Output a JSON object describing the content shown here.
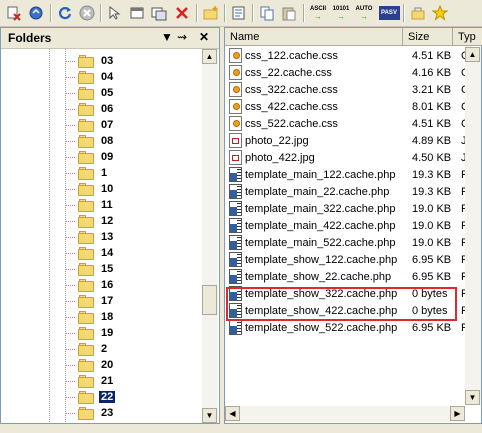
{
  "toolbar": {
    "buttons": [
      {
        "name": "disconnect-icon"
      },
      {
        "name": "reconnect-icon"
      },
      {
        "name": "refresh-icon"
      },
      {
        "name": "stop-icon"
      },
      {
        "name": "move-icon"
      },
      {
        "name": "copy-to-icon"
      },
      {
        "name": "move-to-icon"
      },
      {
        "name": "delete-icon"
      },
      {
        "name": "new-folder-icon"
      },
      {
        "name": "edit-icon"
      },
      {
        "name": "copy-icon"
      },
      {
        "name": "paste-icon"
      },
      {
        "name": "ascii-mode-icon"
      },
      {
        "name": "binary-mode-icon"
      },
      {
        "name": "auto-mode-icon"
      },
      {
        "name": "pasv-icon"
      },
      {
        "name": "add-favorite-icon"
      },
      {
        "name": "bookmark-star-icon"
      }
    ],
    "ascii_label": "ASCII",
    "binary_label": "10101",
    "auto_label": "AUTO",
    "pasv_label": "PASV"
  },
  "folders_panel": {
    "title": "Folders",
    "pin_icon": "pin-icon",
    "close_icon": "close-icon",
    "items": [
      {
        "label": "03"
      },
      {
        "label": "04"
      },
      {
        "label": "05"
      },
      {
        "label": "06"
      },
      {
        "label": "07"
      },
      {
        "label": "08"
      },
      {
        "label": "09"
      },
      {
        "label": "1"
      },
      {
        "label": "10"
      },
      {
        "label": "11"
      },
      {
        "label": "12"
      },
      {
        "label": "13"
      },
      {
        "label": "14"
      },
      {
        "label": "15"
      },
      {
        "label": "16"
      },
      {
        "label": "17"
      },
      {
        "label": "18"
      },
      {
        "label": "19"
      },
      {
        "label": "2"
      },
      {
        "label": "20"
      },
      {
        "label": "21"
      },
      {
        "label": "22",
        "selected": true
      },
      {
        "label": "23"
      }
    ]
  },
  "file_list": {
    "columns": {
      "name": "Name",
      "size": "Size",
      "type": "Typ"
    },
    "files": [
      {
        "name": "css_122.cache.css",
        "size": "4.51 KB",
        "type": "Cas",
        "icon": "css-file-icon"
      },
      {
        "name": "css_22.cache.css",
        "size": "4.16 KB",
        "type": "Cas",
        "icon": "css-file-icon"
      },
      {
        "name": "css_322.cache.css",
        "size": "3.21 KB",
        "type": "Cas",
        "icon": "css-file-icon"
      },
      {
        "name": "css_422.cache.css",
        "size": "8.01 KB",
        "type": "Cas",
        "icon": "css-file-icon"
      },
      {
        "name": "css_522.cache.css",
        "size": "4.51 KB",
        "type": "Cas",
        "icon": "css-file-icon"
      },
      {
        "name": "photo_22.jpg",
        "size": "4.89 KB",
        "type": "JPG",
        "icon": "jpg-file-icon"
      },
      {
        "name": "photo_422.jpg",
        "size": "4.50 KB",
        "type": "JPG",
        "icon": "jpg-file-icon"
      },
      {
        "name": "template_main_122.cache.php",
        "size": "19.3 KB",
        "type": "PHP",
        "icon": "php-file-icon"
      },
      {
        "name": "template_main_22.cache.php",
        "size": "19.3 KB",
        "type": "PHP",
        "icon": "php-file-icon"
      },
      {
        "name": "template_main_322.cache.php",
        "size": "19.0 KB",
        "type": "PHP",
        "icon": "php-file-icon"
      },
      {
        "name": "template_main_422.cache.php",
        "size": "19.0 KB",
        "type": "PHP",
        "icon": "php-file-icon"
      },
      {
        "name": "template_main_522.cache.php",
        "size": "19.0 KB",
        "type": "PHP",
        "icon": "php-file-icon"
      },
      {
        "name": "template_show_122.cache.php",
        "size": "6.95 KB",
        "type": "PHP",
        "icon": "php-file-icon"
      },
      {
        "name": "template_show_22.cache.php",
        "size": "6.95 KB",
        "type": "PHP",
        "icon": "php-file-icon"
      },
      {
        "name": "template_show_322.cache.php",
        "size": "0 bytes",
        "type": "PHP",
        "icon": "php-file-icon"
      },
      {
        "name": "template_show_422.cache.php",
        "size": "0 bytes",
        "type": "PHP",
        "icon": "php-file-icon"
      },
      {
        "name": "template_show_522.cache.php",
        "size": "6.95 KB",
        "type": "PHP",
        "icon": "php-file-icon"
      }
    ]
  },
  "colors": {
    "selection": "#0a246a",
    "highlight_border": "#e0282e",
    "panel_bg": "#ece9d8"
  }
}
